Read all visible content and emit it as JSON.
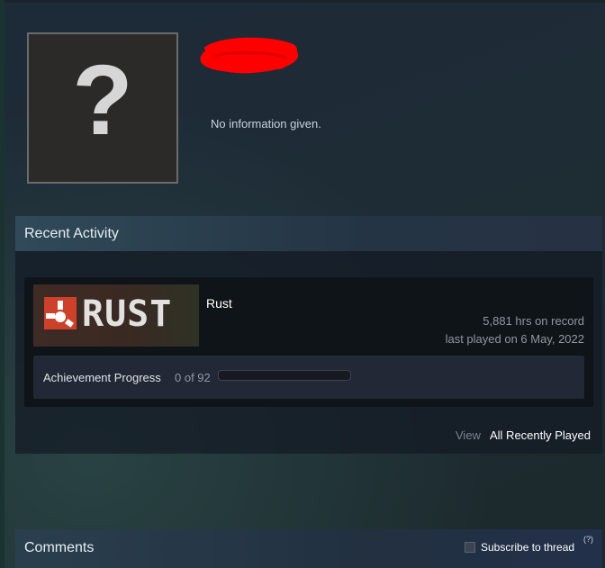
{
  "profile": {
    "avatar_glyph": "?",
    "summary": "No information given."
  },
  "recent_activity": {
    "title": "Recent Activity",
    "games": [
      {
        "name": "Rust",
        "logo_text": "RUST",
        "hours": "5,881 hrs on record",
        "last_played": "last played on 6 May, 2022",
        "achievements": {
          "label": "Achievement Progress",
          "count_text": "0 of 92",
          "progress": 0
        }
      }
    ],
    "view_prefix": "View",
    "view_link": "All Recently Played"
  },
  "comments": {
    "title": "Comments",
    "subscribe_label": "Subscribe to thread",
    "help_mark": "(?)"
  },
  "colors": {
    "redaction": "#ff0000",
    "rust_logo": "#cd412b",
    "progress_fill": "#1a9fff"
  }
}
